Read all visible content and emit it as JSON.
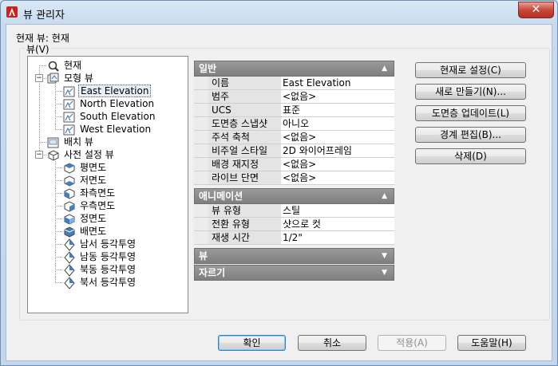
{
  "window": {
    "title": "뷰 관리자",
    "close": "✕"
  },
  "current_view_label": "현재 뷰: 현재",
  "views_group": {
    "label": "뷰(V)"
  },
  "tree": [
    {
      "label": "현재",
      "icon": "zoom-icon"
    },
    {
      "label": "모형 뷰",
      "icon": "model-view-icon",
      "toggle": "−"
    },
    {
      "label": "East Elevation",
      "icon": "view-icon",
      "selected": true
    },
    {
      "label": "North Elevation",
      "icon": "view-icon"
    },
    {
      "label": "South Elevation",
      "icon": "view-icon"
    },
    {
      "label": "West Elevation",
      "icon": "view-icon"
    },
    {
      "label": "배치 뷰",
      "icon": "layout-view-icon"
    },
    {
      "label": "사전 설정 뷰",
      "icon": "preset-view-icon",
      "toggle": "−"
    },
    {
      "label": "평면도",
      "icon": "cube-top-icon"
    },
    {
      "label": "저면도",
      "icon": "cube-bottom-icon"
    },
    {
      "label": "좌측면도",
      "icon": "cube-left-icon"
    },
    {
      "label": "우측면도",
      "icon": "cube-right-icon"
    },
    {
      "label": "정면도",
      "icon": "cube-front-icon"
    },
    {
      "label": "배면도",
      "icon": "cube-back-icon"
    },
    {
      "label": "남서 등각투영",
      "icon": "iso-icon"
    },
    {
      "label": "남동 등각투영",
      "icon": "iso-icon"
    },
    {
      "label": "북동 등각투영",
      "icon": "iso-icon"
    },
    {
      "label": "북서 등각투영",
      "icon": "iso-icon"
    }
  ],
  "palette": {
    "general": {
      "title": "일반",
      "arrow": "▲",
      "rows": [
        {
          "k": "이름",
          "v": "East Elevation"
        },
        {
          "k": "범주",
          "v": "<없음>"
        },
        {
          "k": "UCS",
          "v": "표준"
        },
        {
          "k": "도면층 스냅샷",
          "v": "아니오"
        },
        {
          "k": "주석 축척",
          "v": "<없음>"
        },
        {
          "k": "비주얼 스타일",
          "v": "2D 와이어프레임"
        },
        {
          "k": "배경 재지정",
          "v": "<없음>"
        },
        {
          "k": "라이브 단면",
          "v": "<없음>"
        }
      ]
    },
    "animation": {
      "title": "애니메이션",
      "arrow": "▲",
      "rows": [
        {
          "k": "뷰 유형",
          "v": "스틸"
        },
        {
          "k": "전환 유형",
          "v": "샷으로 컷"
        },
        {
          "k": "재생 시간",
          "v": "1/2\""
        }
      ]
    },
    "view": {
      "title": "뷰",
      "arrow": "▼"
    },
    "clip": {
      "title": "자르기",
      "arrow": "▼"
    }
  },
  "buttons": {
    "set_current": "현재로 설정(C)",
    "new": "새로 만들기(N)...",
    "update_layers": "도면층 업데이트(L)",
    "edit_boundaries": "경계 편집(B)...",
    "delete": "삭제(D)",
    "ok": "확인",
    "cancel": "취소",
    "apply": "적용(A)",
    "help": "도움말(H)"
  }
}
